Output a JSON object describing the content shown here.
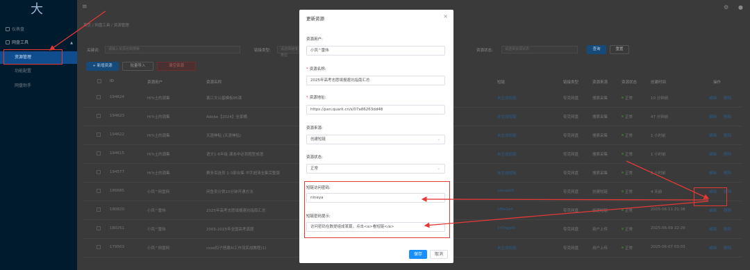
{
  "sidebar": {
    "logo": "大",
    "items": [
      {
        "label": "仪表盘"
      },
      {
        "label": "网盘工具"
      },
      {
        "label": "资源管理"
      },
      {
        "label": "功能配置"
      },
      {
        "label": "网盘助手"
      }
    ]
  },
  "topbar": {
    "menu_icon": "≡",
    "settings_icon": "⚙",
    "user_icon": "●"
  },
  "breadcrumb": [
    "首页",
    "网盘工具",
    "资源管理"
  ],
  "search": {
    "keyword_label": "关键词:",
    "keyword_placeholder": "请输入资源名称搜索",
    "link_type_label": "链接类型:",
    "link_type_placeholder": "请选择链接类型",
    "status_label": "资源状态:",
    "status_placeholder": "请选择资源状态",
    "search_btn": "查询",
    "reset_btn": "重置"
  },
  "toolbar": {
    "add": "+ 新增资源",
    "import": "批量导入",
    "clear": "清空资源"
  },
  "table": {
    "headers": [
      "ID",
      "资源用户",
      "资源名称",
      "短链",
      "链接类型",
      "资源来源",
      "资源状态",
      "创建时间",
      "操作"
    ],
    "rows": [
      {
        "id": "194624",
        "user": "Hi'h土的源集",
        "name": "袁江文公基模板95课",
        "short": "未生成短链",
        "type": "夸克网盘",
        "source": "搜索采集",
        "status": "正常",
        "time": "10 分钟前",
        "edit": "编辑",
        "del": "删除"
      },
      {
        "id": "194623",
        "user": "Hi'h土的源集",
        "name": "Adobe【2024】全家桶",
        "short": "未生成短链",
        "type": "夸克网盘",
        "source": "搜索采集",
        "status": "正常",
        "time": "47 分钟前",
        "edit": "编辑",
        "del": "删除"
      },
      {
        "id": "194622",
        "user": "Hi'h土的源集",
        "name": "天涯神贴 (天涯神贴)",
        "short": "未生成短链",
        "type": "夸克网盘",
        "source": "搜索采集",
        "status": "正常",
        "time": "1 小时前",
        "edit": "编辑",
        "del": "删除"
      },
      {
        "id": "194615",
        "user": "Hi'h土的源集",
        "name": "语文1-6年级 课本中必背题型成语",
        "short": "未生成短链",
        "type": "夸克网盘",
        "source": "搜索采集",
        "status": "正常",
        "time": "1 小时前",
        "edit": "编辑",
        "del": "删除"
      },
      {
        "id": "194577",
        "user": "Hi'h土的源集",
        "name": "赛多百选员 1-3部合集 中字超清全集完整版",
        "short": "未生成短链",
        "type": "夸克网盘",
        "source": "搜索采集",
        "status": "正常",
        "time": "3 小时前",
        "edit": "编辑",
        "del": "删除"
      },
      {
        "id": "186685",
        "user": "小凤^网盘网",
        "name": "闲鱼卖分销10分钟开通方法",
        "short": "ooxupbB",
        "type": "夸克网盘",
        "source": "创建短链",
        "status": "正常",
        "time": "4 天前",
        "edit": "编辑",
        "del": "删除"
      },
      {
        "id": "180820",
        "user": "小凤^雷炜",
        "name": "2025年高考志愿填报避坑指南汇总",
        "short": "nf8e1e6",
        "type": "夸克网盘",
        "source": "创建短链",
        "status": "正常",
        "time": "2025-06-11 21:38",
        "edit": "编辑",
        "del": "删除"
      },
      {
        "id": "180251",
        "user": "小凤^雷炜",
        "name": "2005-2025年全国高考真题",
        "short": "1d7oga6l",
        "type": "夸克网盘",
        "source": "用户上传",
        "status": "正常",
        "time": "2025-06-09 22:29",
        "edit": "编辑",
        "del": "删除"
      },
      {
        "id": "179503",
        "user": "小凤^网盘网",
        "name": "coze扣子搭建AI工作流实战教程(1)",
        "short": "未生成短链",
        "type": "夸克网盘",
        "source": "用户上传",
        "status": "正常",
        "time": "2025-06-07 03:03",
        "edit": "编辑",
        "del": "删除"
      }
    ]
  },
  "modal": {
    "title": "更新资源",
    "close": "×",
    "user_label": "资源用户:",
    "user_value": "小凤^雷炜",
    "name_label": "资源名称:",
    "name_value": "2025年高考志愿填报避坑指南汇总",
    "url_label": "资源地址:",
    "url_value": "https://pan.quark.cn/s/07a86263dd48",
    "source_label": "资源来源:",
    "source_value": "创建短链",
    "status_label": "资源状态:",
    "status_value": "正常",
    "pwd_label": "短链访问密码:",
    "pwd_value": "nineya",
    "hint_label": "短链密码提示:",
    "hint_value": "访问密码在数提组成某篇，点击<a>看短链</a>",
    "save": "保存",
    "cancel": "取消"
  },
  "colors": {
    "accent": "#1890ff",
    "annotation": "#e53935",
    "sidebar": "#011b2e"
  }
}
